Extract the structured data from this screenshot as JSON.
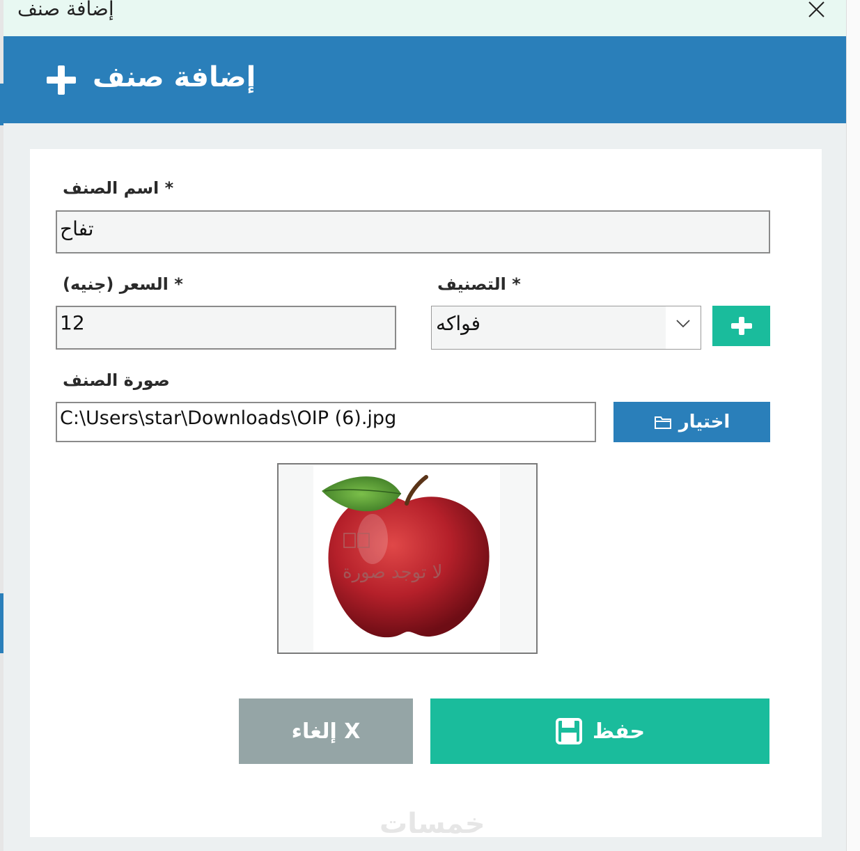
{
  "window": {
    "title": "إضافة صنف"
  },
  "header": {
    "title": "إضافة صنف",
    "icon": "plus-icon"
  },
  "form": {
    "name_label": "* اسم الصنف",
    "name_value": "تفاح",
    "price_label": "* السعر (جنيه)",
    "price_value": "12",
    "category_label": "* التصنيف",
    "category_value": "فواكه",
    "image_label": "صورة الصنف",
    "image_path": "C:\\Users\\star\\Downloads\\OIP (6).jpg",
    "browse_label": "اختيار",
    "no_image_text": "لا توجد صورة"
  },
  "actions": {
    "save_label": "حفظ",
    "cancel_label": "إلغاء X"
  },
  "watermark": "خمسات",
  "colors": {
    "header_blue": "#2a7fba",
    "accent_green": "#1abc9c",
    "cancel_gray": "#95a5a6",
    "titlebar_bg": "#e8f8f2",
    "window_bg": "#ecf0f1"
  }
}
